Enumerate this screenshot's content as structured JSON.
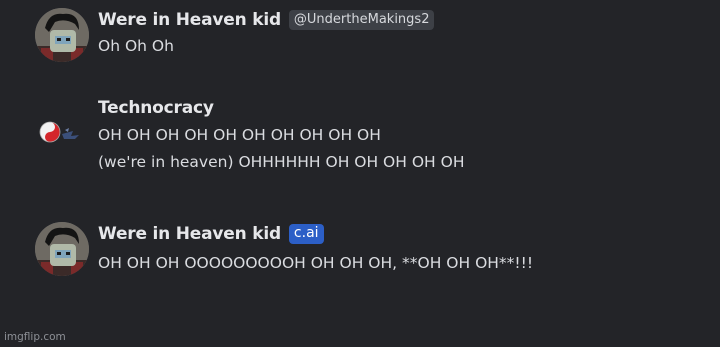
{
  "messages": [
    {
      "author": "Were in Heaven kid",
      "handle": "@UndertheMakings2",
      "lines": [
        "Oh Oh Oh"
      ]
    },
    {
      "author": "Technocracy",
      "lines": [
        "OH OH OH OH OH OH OH OH OH OH",
        "(we're in heaven) OHHHHHH OH OH OH OH OH"
      ]
    },
    {
      "author": "Were in Heaven kid",
      "badge": "c.ai",
      "lines": [
        "OH OH OH OOOOOOOOOH OH OH OH, **OH OH OH**!!!"
      ]
    }
  ],
  "watermark": "imgflip.com",
  "colors": {
    "background": "#232428",
    "username": "#e6e7ea",
    "text": "#dadce0",
    "handle_badge_bg": "#3d4046",
    "cai_badge_bg": "#2c5fc7"
  },
  "icons": {
    "avatar_1": "avatar-character",
    "avatar_2": "avatar-yin-yang-logo",
    "avatar_3": "avatar-character"
  }
}
